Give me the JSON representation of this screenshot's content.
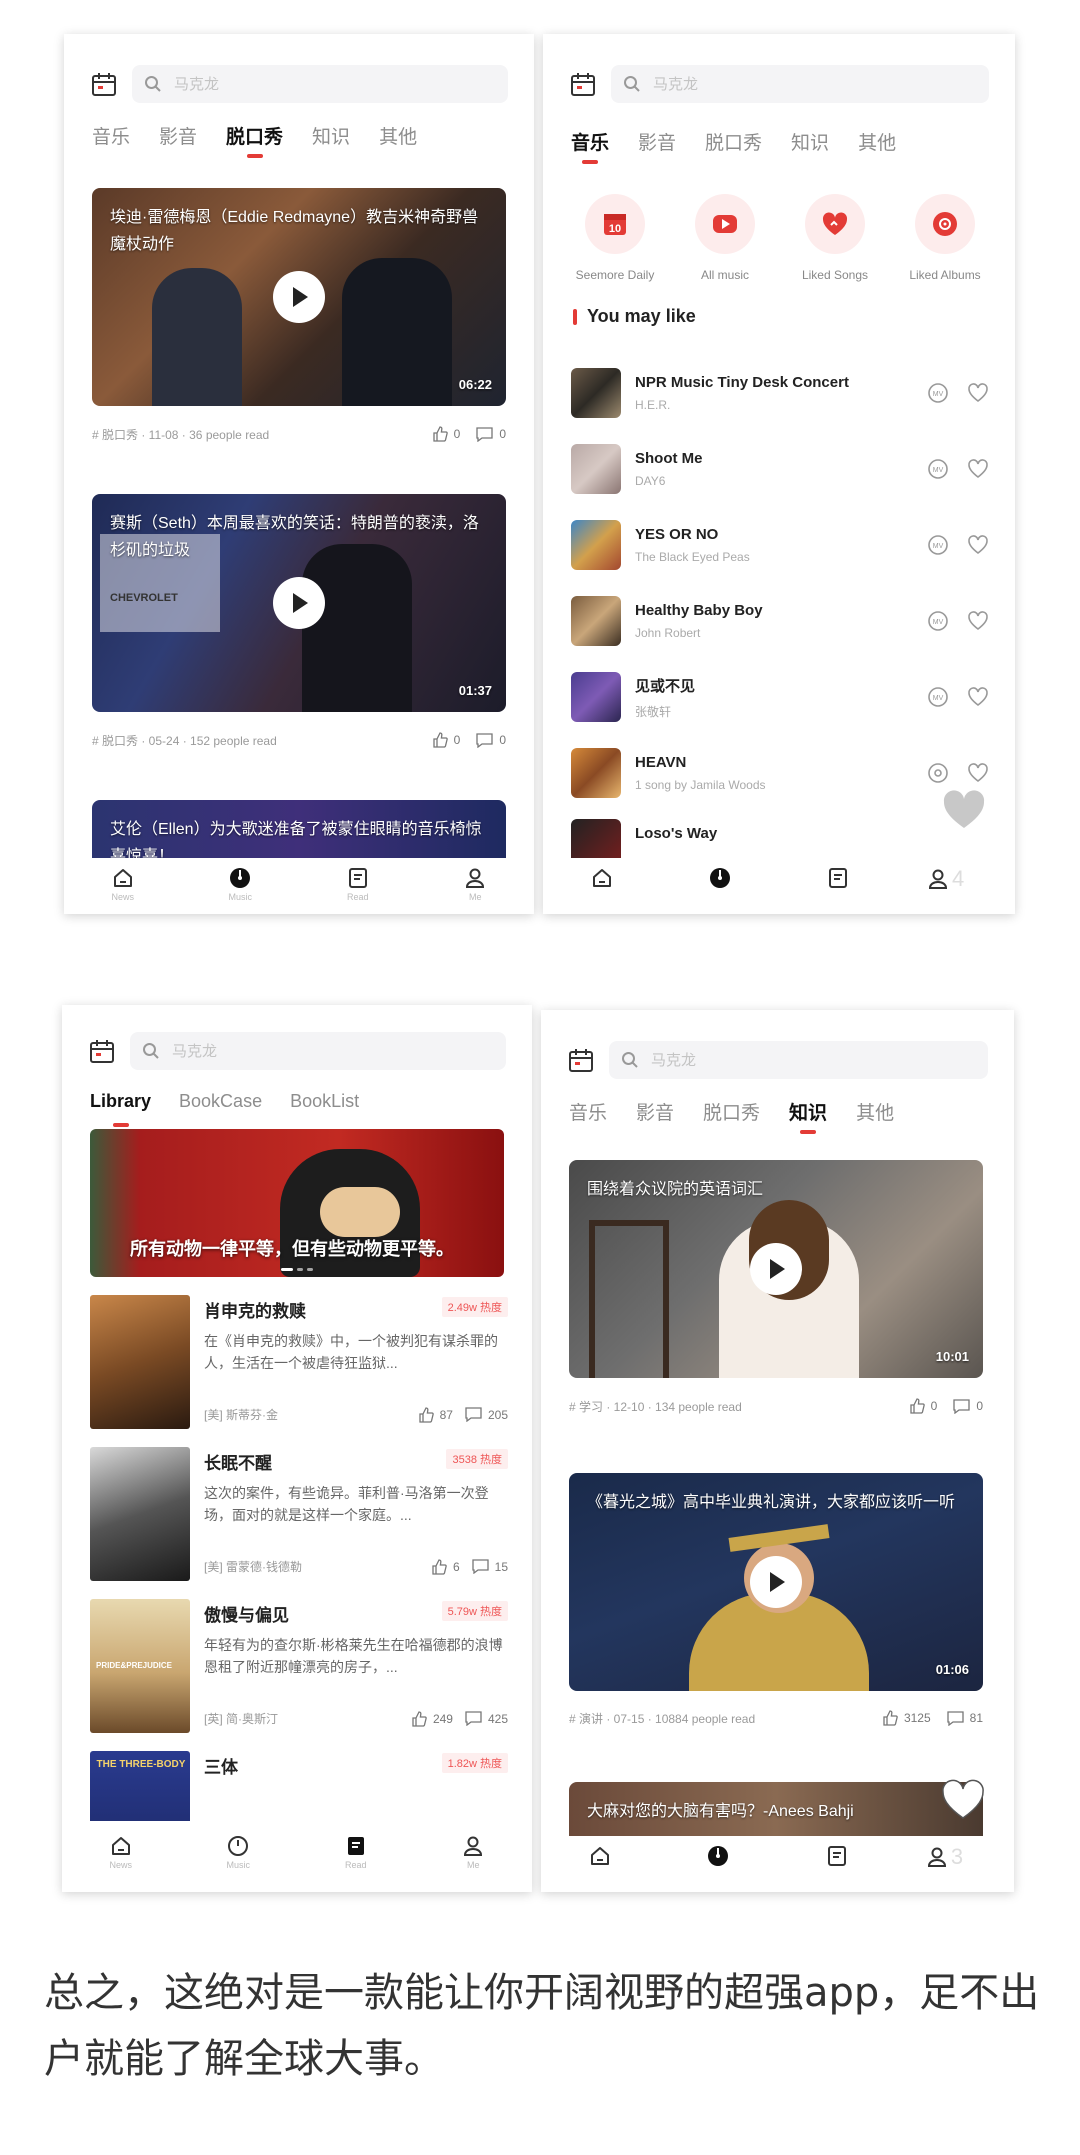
{
  "search_placeholder": "马克龙",
  "news_tabs": [
    "音乐",
    "影音",
    "脱口秀",
    "知识",
    "其他"
  ],
  "nav_labels": [
    "News",
    "Music",
    "Read",
    "Me"
  ],
  "talkshow": {
    "active_tab": 2,
    "videos": [
      {
        "title": "埃迪·雷德梅恩（Eddie Redmayne）教吉米神奇野兽魔杖动作",
        "duration": "06:22",
        "meta": "# 脱口秀 · 11-08 · 36 people read",
        "likes": "0",
        "comments": "0"
      },
      {
        "title": "赛斯（Seth）本周最喜欢的笑话：特朗普的亵渎，洛杉矶的垃圾",
        "duration": "01:37",
        "meta": "# 脱口秀 · 05-24 · 152 people read",
        "likes": "0",
        "comments": "0"
      },
      {
        "title": "艾伦（Ellen）为大歌迷准备了被蒙住眼睛的音乐椅惊喜惊喜！",
        "duration": "",
        "meta": "",
        "likes": "",
        "comments": ""
      }
    ],
    "watermark_text": "CHEVROLET"
  },
  "music": {
    "active_tab": 0,
    "categories": [
      {
        "label": "Seemore Daily",
        "icon": "calendar-10-icon",
        "day": "10"
      },
      {
        "label": "All music",
        "icon": "play-icon"
      },
      {
        "label": "Liked Songs",
        "icon": "heart-icon"
      },
      {
        "label": "Liked Albums",
        "icon": "album-icon"
      }
    ],
    "section_title": "You may like",
    "songs": [
      {
        "name": "NPR Music Tiny Desk Concert",
        "artist": "H.E.R."
      },
      {
        "name": "Shoot Me",
        "artist": "DAY6"
      },
      {
        "name": "YES OR NO",
        "artist": "The Black Eyed Peas"
      },
      {
        "name": "Healthy Baby Boy",
        "artist": "John Robert"
      },
      {
        "name": "见或不见",
        "artist": "张敬轩"
      },
      {
        "name": "HEAVN",
        "artist": "1 song by Jamila Woods"
      },
      {
        "name": "Loso's Way",
        "artist": ""
      }
    ],
    "badge_number": "4"
  },
  "library": {
    "tabs": [
      "Library",
      "BookCase",
      "BookList"
    ],
    "active_tab": 0,
    "banner_title": "所有动物一律平等，但有些动物更平等。",
    "books": [
      {
        "title": "肖申克的救赎",
        "hot": "2.49w 热度",
        "desc": "在《肖申克的救赎》中，一个被判犯有谋杀罪的人，生活在一个被虐待狂监狱...",
        "author": "[美] 斯蒂芬·金",
        "likes": "87",
        "comments": "205"
      },
      {
        "title": "长眠不醒",
        "hot": "3538 热度",
        "desc": "这次的案件，有些诡异。菲利普·马洛第一次登场，面对的就是这样一个家庭。...",
        "author": "[美] 雷蒙德·钱德勒",
        "likes": "6",
        "comments": "15"
      },
      {
        "title": "傲慢与偏见",
        "hot": "5.79w 热度",
        "desc": "年轻有为的查尔斯·彬格莱先生在哈福德郡的浪博恩租了附近那幢漂亮的房子，...",
        "author": "[英] 简·奥斯汀",
        "likes": "249",
        "comments": "425"
      },
      {
        "title": "三体",
        "hot": "1.82w 热度",
        "desc": "",
        "author": "",
        "likes": "",
        "comments": ""
      }
    ],
    "cover_texts": [
      "PRIDE&PREJUDICE",
      "THE THREE-BODY"
    ]
  },
  "knowledge": {
    "active_tab": 3,
    "videos": [
      {
        "title": "围绕着众议院的英语词汇",
        "duration": "10:01",
        "meta": "# 学习 · 12-10 · 134 people read",
        "likes": "0",
        "comments": "0"
      },
      {
        "title": "《暮光之城》高中毕业典礼演讲，大家都应该听一听",
        "duration": "01:06",
        "meta": "# 演讲 · 07-15 · 10884 people read",
        "likes": "3125",
        "comments": "81"
      },
      {
        "title": "大麻对您的大脑有害吗？-Anees Bahji",
        "duration": "",
        "meta": "",
        "likes": "",
        "comments": ""
      }
    ],
    "badge_number": "3"
  },
  "caption": "总之，这绝对是一款能让你开阔视野的超强app，足不出户就能了解全球大事。",
  "colors": {
    "accent": "#e33b36",
    "tab_inactive": "#8d8d8d"
  }
}
